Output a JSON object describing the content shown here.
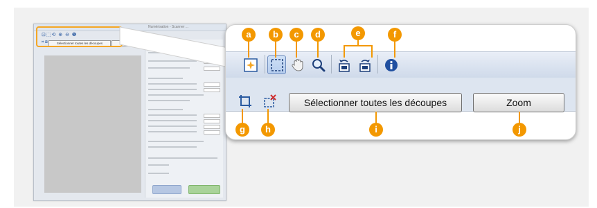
{
  "mini_window": {
    "title": "Numérisation - Scanner ...",
    "select_all_label": "Sélectionner toutes les découpes",
    "zoom_label": "Zoom",
    "toolbar_icons_text": "⊡⬚⟲ ⊕ ⊖ ❶",
    "crop_icons_text": "⌗ ⊠",
    "scan_button_label": "Numérisation",
    "preview_button_label": "Aperçu"
  },
  "toolbar": {
    "select_all_label": "Sélectionner toutes les découpes",
    "zoom_label": "Zoom"
  },
  "callouts": {
    "a": "a",
    "b": "b",
    "c": "c",
    "d": "d",
    "e": "e",
    "f": "f",
    "g": "g",
    "h": "h",
    "i": "i",
    "j": "j"
  },
  "colors": {
    "badge": "#f39800",
    "highlight": "#f5a623",
    "icon_blue": "#2a5aa0"
  },
  "icons": [
    "auto-crop-icon",
    "selection-frame-icon",
    "hand-icon",
    "magnifier-icon",
    "rotate-left-icon",
    "rotate-right-icon",
    "info-icon",
    "crop-icon",
    "delete-crop-icon"
  ]
}
